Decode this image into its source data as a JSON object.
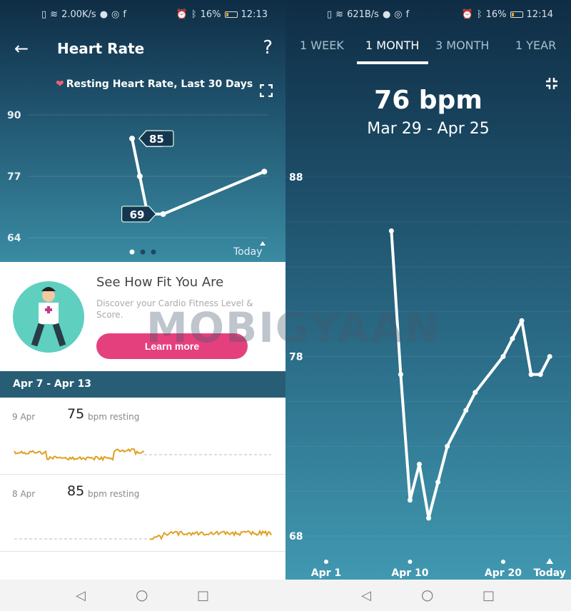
{
  "left": {
    "status": {
      "speed": "2.00K/s",
      "battery": "16%",
      "time": "12:13"
    },
    "header": {
      "title": "Heart Rate",
      "back_icon": "arrow-left-icon",
      "help": "?"
    },
    "chart_title": "Resting Heart Rate, Last 30 Days",
    "chart_data": {
      "type": "line",
      "title": "Resting Heart Rate, Last 30 Days",
      "yticks": [
        "90",
        "77",
        "64"
      ],
      "ylim": [
        64,
        90
      ],
      "x_label_today": "Today",
      "x": [
        8,
        9,
        10,
        12,
        25
      ],
      "values": [
        85,
        77,
        69,
        69,
        78
      ],
      "annotations": [
        {
          "label": "85",
          "value": 85
        },
        {
          "label": "69",
          "value": 69
        }
      ],
      "grid": true
    },
    "pager": {
      "pages": 3,
      "active": 0
    },
    "card": {
      "title": "See How Fit You Are",
      "text": "Discover your Cardio Fitness Level & Score.",
      "button": "Learn more"
    },
    "week_header": "Apr 7 - Apr 13",
    "days": [
      {
        "date": "9 Apr",
        "bpm": "75",
        "unit": "bpm resting"
      },
      {
        "date": "8 Apr",
        "bpm": "85",
        "unit": "bpm resting"
      }
    ],
    "colors": {
      "accent": "#e5407e",
      "week_bar": "#275e75",
      "trace": "#e0a020"
    }
  },
  "right": {
    "status": {
      "speed": "621B/s",
      "battery": "16%",
      "time": "12:14"
    },
    "tabs": [
      "1 WEEK",
      "1 MONTH",
      "3 MONTH",
      "1 YEAR"
    ],
    "active_tab": 1,
    "summary": {
      "value": "76 bpm",
      "range": "Mar 29 - Apr 25"
    },
    "chart_data": {
      "type": "line",
      "yticks": [
        "88",
        "78",
        "68"
      ],
      "ylim": [
        68,
        88
      ],
      "xticks": [
        "Apr 1",
        "Apr 10",
        "Apr 20",
        "Today"
      ],
      "xtick_days": [
        1,
        10,
        20,
        25
      ],
      "x": [
        8,
        9,
        10,
        11,
        12,
        13,
        14,
        16,
        17,
        20,
        21,
        22,
        23,
        24,
        25
      ],
      "values": [
        85,
        77,
        70,
        72,
        69,
        71,
        73,
        75,
        76,
        78,
        79,
        80,
        77,
        77,
        78
      ],
      "grid": true
    }
  },
  "watermark": "MOBIGYAAN"
}
